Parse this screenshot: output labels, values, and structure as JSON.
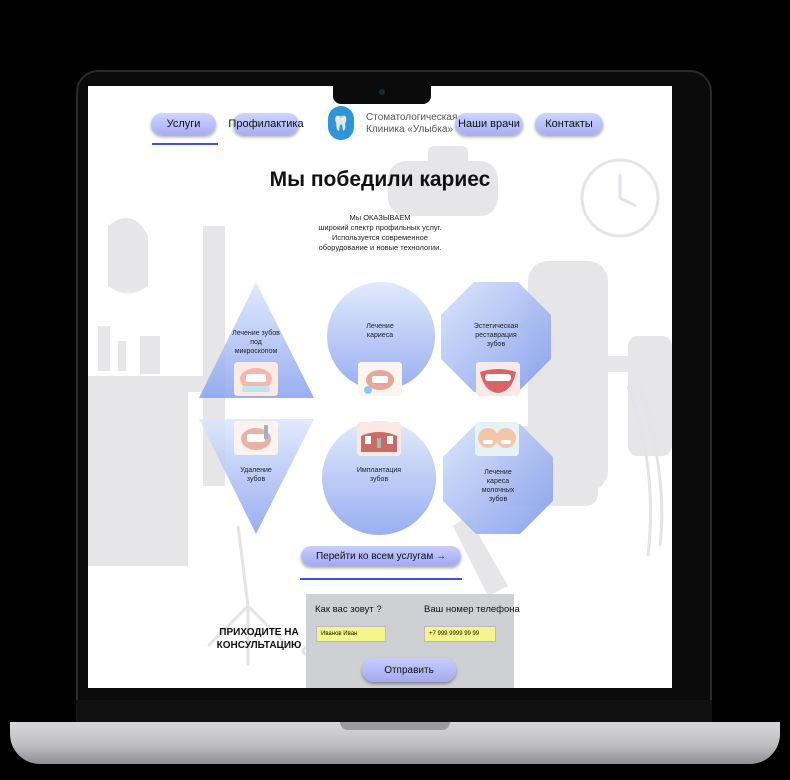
{
  "nav": {
    "services": "Услуги",
    "prevention": "Профилактика",
    "doctors": "Наши врачи",
    "contacts": "Контакты"
  },
  "brand": {
    "logo_text": "УЛЫБКА",
    "name_line1": "Стоматологическая",
    "name_line2": "Клиника «Улыбка»"
  },
  "hero": {
    "title": "Мы победили кариес",
    "intro_lines": [
      "Мы ОКАЗЫВАЕМ",
      "широкий спектр профильных услуг.",
      "Используется современное",
      "оборудование и новые технологии."
    ]
  },
  "services": [
    {
      "lines": [
        "Лечение зубов",
        "под",
        "микроскопом"
      ]
    },
    {
      "lines": [
        "Лечение",
        "кариеса"
      ]
    },
    {
      "lines": [
        "Эстетическая",
        "реставрация",
        "зубов"
      ]
    },
    {
      "lines": [
        "Удаление",
        "зубов"
      ]
    },
    {
      "lines": [
        "Имплантация",
        "зубов"
      ]
    },
    {
      "lines": [
        "Лечение",
        "кареса",
        "молочных",
        "зубов"
      ]
    }
  ],
  "cta": {
    "all_services": "Перейти ко всем услугам →"
  },
  "consult": {
    "line1": "ПРИХОДИТЕ НА",
    "line2": "КОНСУЛЬТАЦИЮ"
  },
  "form": {
    "name_label": "Как вас зовут ?",
    "name_value": "Иванов Иван",
    "phone_label": "Ваш номер телефона",
    "phone_value": "+7 999 9999 99 99",
    "submit": "Отправить"
  },
  "colors": {
    "accent": "#3e55d6",
    "button": "#a6aef3",
    "shape_fill": "#8fa9ef",
    "input_bg": "#f6f48c",
    "form_bg": "#cfd0d3"
  }
}
